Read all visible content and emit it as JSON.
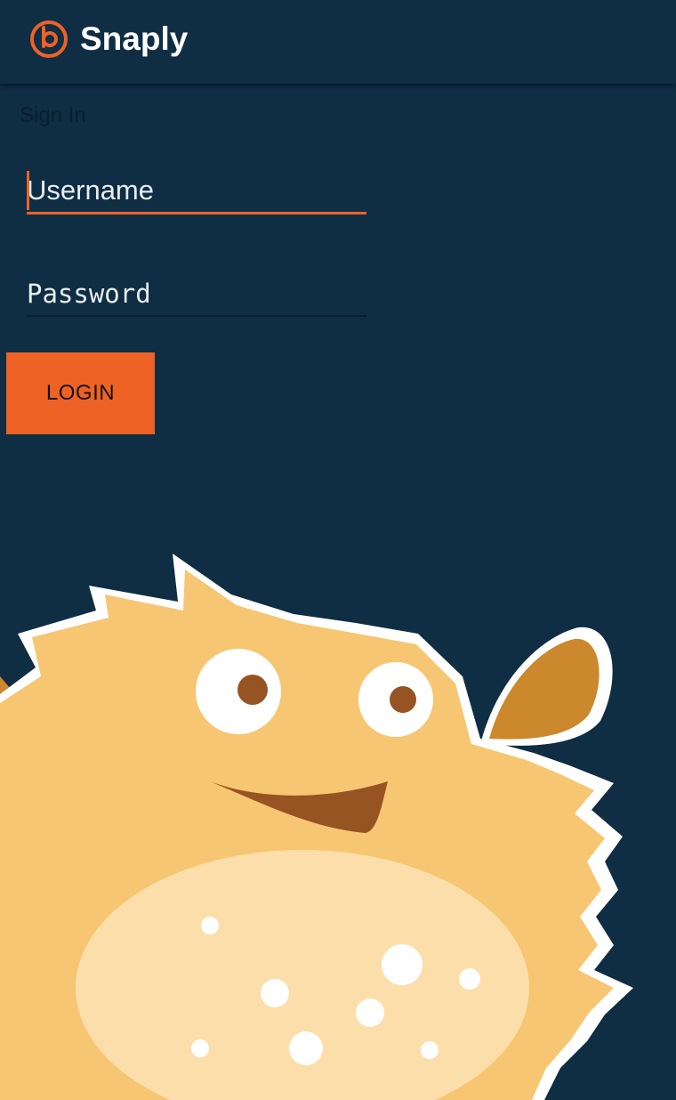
{
  "app_bar": {
    "title": "Snaply",
    "logo_icon": "snaply-logo-icon"
  },
  "form": {
    "section_label": "Sign In",
    "username_placeholder": "Username",
    "password_placeholder": "Password",
    "login_label": "LOGIN"
  },
  "illustration": {
    "icon": "pufferfish-mascot"
  },
  "colors": {
    "background": "#0f2d43",
    "accent": "#ee6226",
    "mascot_body": "#f7c672",
    "mascot_belly": "#fcdeab",
    "mascot_fin": "#cc882c"
  }
}
